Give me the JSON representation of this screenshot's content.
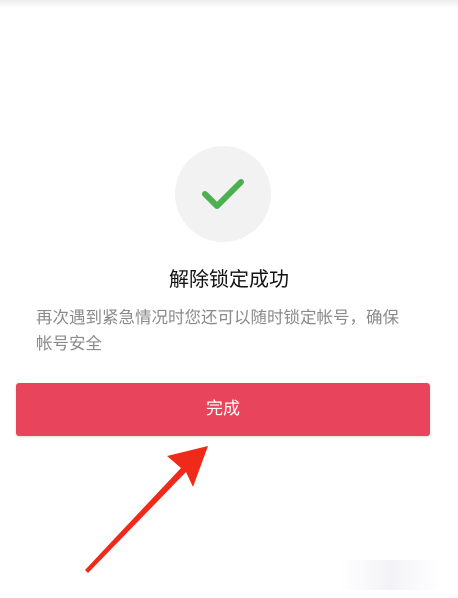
{
  "result": {
    "title": "解除锁定成功",
    "description": "再次遇到紧急情况时您还可以随时锁定帐号，确保帐号安全"
  },
  "actions": {
    "done_label": "完成"
  },
  "icons": {
    "success": "check-icon",
    "annotation": "red-arrow-icon"
  },
  "colors": {
    "accent": "#e8445b",
    "success": "#4caf50",
    "annotation": "#f02a1a"
  }
}
